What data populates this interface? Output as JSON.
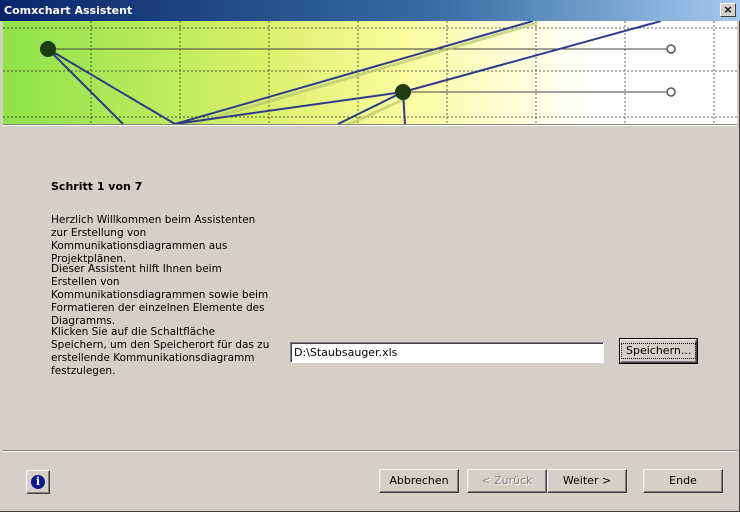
{
  "window": {
    "title": "Comxchart Assistent",
    "close_glyph": "×"
  },
  "content": {
    "step": "Schritt 1 von 7",
    "paragraphs": [
      "Herzlich Willkommen beim Assistenten zur Erstellung von Kommunikationsdiagrammen aus Projektplänen.",
      "Dieser Assistent hilft Ihnen beim Erstellen von Kommunikationsdiagrammen sowie beim Formatieren der einzelnen Elemente des Diagramms.",
      "Klicken Sie auf die Schaltfläche Speichern, um den Speicherort für das zu erstellende Kommunikationsdiagramm festzulegen."
    ],
    "path_value": "D:\\Staubsauger.xls",
    "save_button": "Speichern..."
  },
  "footer": {
    "info_icon": "info-icon",
    "info_glyph": "i",
    "cancel": "Abbrechen",
    "back": "< Zurück",
    "next": "Weiter >",
    "finish": "Ende"
  }
}
